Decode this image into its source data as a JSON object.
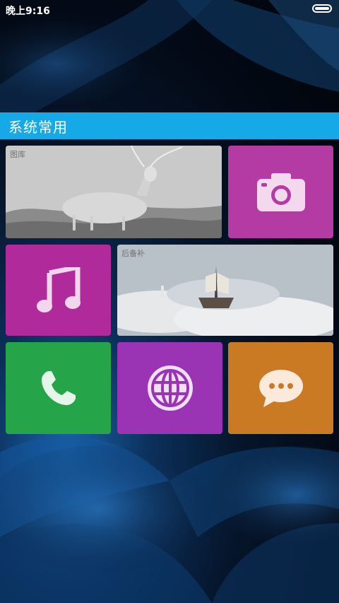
{
  "status_bar": {
    "time": "晚上9:16",
    "battery_icon": "battery-icon"
  },
  "group": {
    "title": "系统常用"
  },
  "tiles": {
    "gallery": {
      "label": "图库",
      "icon": "deer-photo"
    },
    "camera": {
      "icon": "camera-icon",
      "color": "#b43aa4"
    },
    "music": {
      "icon": "music-note-icon",
      "color": "#b02a9c"
    },
    "weather": {
      "label": "后备补",
      "icon": "ship-photo"
    },
    "phone": {
      "icon": "phone-icon",
      "color": "#26a44a"
    },
    "browser": {
      "icon": "globe-icon",
      "color": "#9b34b4"
    },
    "messages": {
      "icon": "chat-bubble-icon",
      "color": "#c97a23"
    }
  },
  "accent_color": "#16a9e8"
}
